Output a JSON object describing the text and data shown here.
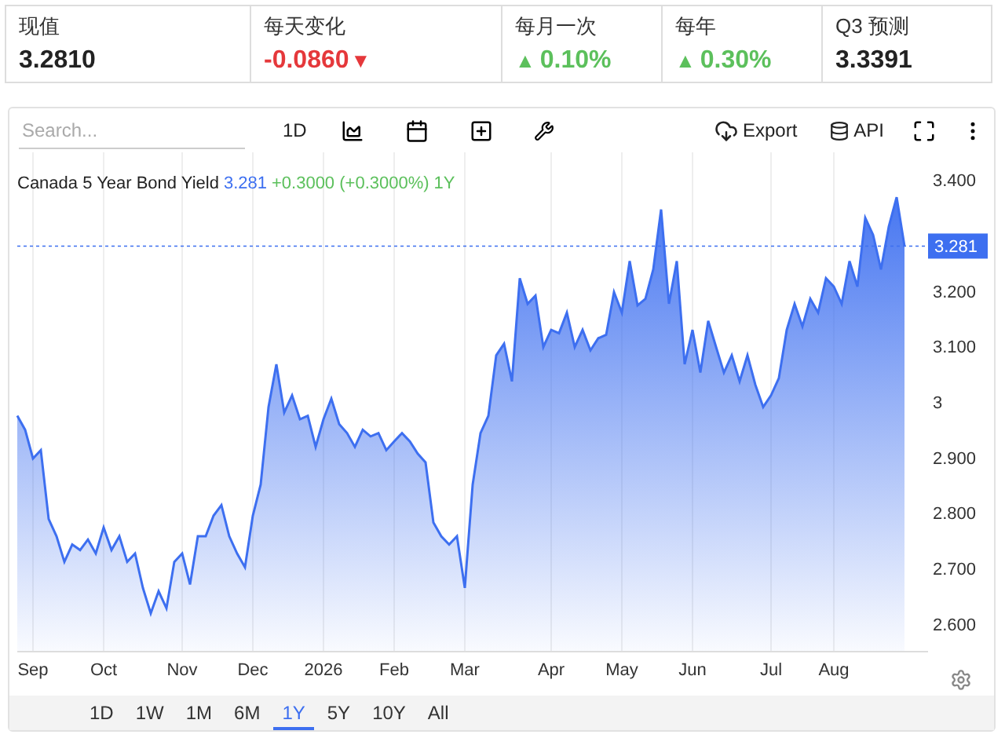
{
  "stats": [
    {
      "label": "现值",
      "value": "3.2810",
      "kind": "plain"
    },
    {
      "label": "每天变化",
      "value": "-0.0860",
      "kind": "down",
      "arrow": "▼"
    },
    {
      "label": "每月一次",
      "value": "0.10%",
      "kind": "up",
      "arrow": "▲"
    },
    {
      "label": "每年",
      "value": "0.30%",
      "kind": "up",
      "arrow": "▲"
    },
    {
      "label": "Q3 预测",
      "value": "3.3391",
      "kind": "plain"
    }
  ],
  "toolbar": {
    "search": {
      "placeholder": "Search..."
    },
    "interval": "1D",
    "export": "Export",
    "api": "API"
  },
  "chart": {
    "legend": {
      "price": "3.281",
      "change": "+0.3000 (+0.3000%)",
      "period": "1Y"
    },
    "chart_data": {
      "type": "area",
      "categories": [
        null,
        null,
        "Sep",
        null,
        null,
        null,
        null,
        null,
        null,
        null,
        null,
        "Oct",
        null,
        null,
        null,
        null,
        null,
        null,
        null,
        null,
        null,
        "Nov",
        null,
        null,
        null,
        null,
        null,
        null,
        null,
        null,
        "Dec",
        null,
        null,
        null,
        null,
        null,
        null,
        null,
        null,
        "2026",
        null,
        null,
        null,
        null,
        null,
        null,
        null,
        null,
        "Feb",
        null,
        null,
        null,
        null,
        null,
        null,
        null,
        null,
        "Mar",
        null,
        null,
        null,
        null,
        null,
        null,
        null,
        null,
        null,
        null,
        "Apr",
        null,
        null,
        null,
        null,
        null,
        null,
        null,
        null,
        "May",
        null,
        null,
        null,
        null,
        null,
        null,
        null,
        null,
        "Jun",
        null,
        null,
        null,
        null,
        null,
        null,
        null,
        null,
        null,
        "Jul",
        null,
        null,
        null,
        null,
        null,
        null,
        null,
        "Aug",
        null,
        null,
        null,
        null,
        null,
        null,
        null,
        null,
        null
      ],
      "ylim": [
        2.55,
        3.45
      ],
      "ref_lines": [
        {
          "axis": "y",
          "value": 3.281,
          "label": "3.281"
        }
      ],
      "grid": true,
      "series": [
        {
          "name": "Canada 5 Year Bond Yield",
          "color": "#3d6ff0",
          "values": [
            2.975,
            2.95,
            2.898,
            2.913,
            2.789,
            2.758,
            2.712,
            2.743,
            2.733,
            2.752,
            2.727,
            2.774,
            2.733,
            2.758,
            2.712,
            2.727,
            2.665,
            2.619,
            2.659,
            2.628,
            2.712,
            2.727,
            2.671,
            2.758,
            2.758,
            2.795,
            2.814,
            2.758,
            2.727,
            2.702,
            2.795,
            2.851,
            2.991,
            3.068,
            2.981,
            3.012,
            2.969,
            2.975,
            2.919,
            2.969,
            3.006,
            2.96,
            2.944,
            2.919,
            2.95,
            2.938,
            2.944,
            2.913,
            2.929,
            2.944,
            2.929,
            2.907,
            2.891,
            2.783,
            2.758,
            2.743,
            2.758,
            2.665,
            2.851,
            2.944,
            2.975,
            3.084,
            3.105,
            3.037,
            3.223,
            3.177,
            3.192,
            3.099,
            3.13,
            3.124,
            3.161,
            3.099,
            3.13,
            3.093,
            3.115,
            3.121,
            3.198,
            3.161,
            3.254,
            3.174,
            3.186,
            3.239,
            3.347,
            3.177,
            3.254,
            3.068,
            3.13,
            3.053,
            3.146,
            3.099,
            3.053,
            3.084,
            3.037,
            3.084,
            3.031,
            2.991,
            3.012,
            3.043,
            3.13,
            3.177,
            3.136,
            3.186,
            3.161,
            3.223,
            3.208,
            3.177,
            3.254,
            3.208,
            3.332,
            3.301,
            3.239,
            3.316,
            3.369,
            3.281
          ]
        }
      ],
      "yticks": [
        {
          "value": 2.6,
          "label": "2.600"
        },
        {
          "value": 2.7,
          "label": "2.700"
        },
        {
          "value": 2.8,
          "label": "2.800"
        },
        {
          "value": 2.9,
          "label": "2.900"
        },
        {
          "value": 3,
          "label": "3"
        },
        {
          "value": 3.1,
          "label": "3.100"
        },
        {
          "value": 3.2,
          "label": "3.200"
        },
        {
          "value": 3.4,
          "label": "3.400"
        }
      ]
    }
  },
  "ranges": [
    {
      "label": "1D",
      "selected": false
    },
    {
      "label": "1W",
      "selected": false
    },
    {
      "label": "1M",
      "selected": false
    },
    {
      "label": "6M",
      "selected": false
    },
    {
      "label": "1Y",
      "selected": true
    },
    {
      "label": "5Y",
      "selected": false
    },
    {
      "label": "10Y",
      "selected": false
    },
    {
      "label": "All",
      "selected": false
    }
  ]
}
